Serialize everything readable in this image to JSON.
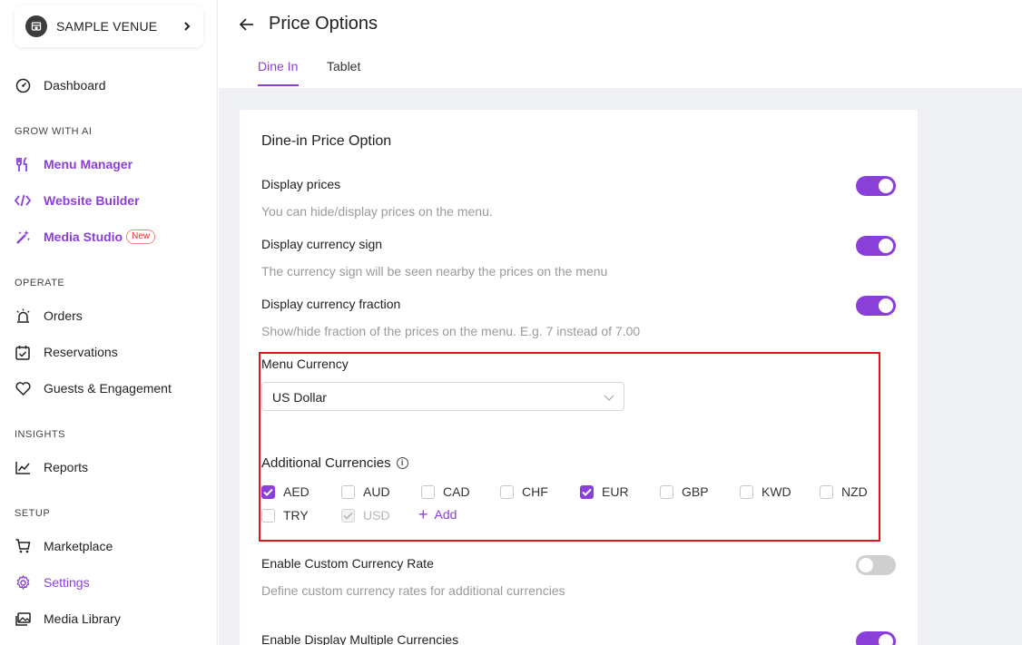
{
  "venue": {
    "name": "SAMPLE VENUE"
  },
  "nav": {
    "dashboard": "Dashboard",
    "grow_label": "GROW WITH AI",
    "menu_manager": "Menu Manager",
    "website_builder": "Website Builder",
    "media_studio": "Media Studio",
    "media_studio_badge": "New",
    "operate_label": "OPERATE",
    "orders": "Orders",
    "reservations": "Reservations",
    "guests": "Guests & Engagement",
    "insights_label": "INSIGHTS",
    "reports": "Reports",
    "setup_label": "SETUP",
    "marketplace": "Marketplace",
    "settings": "Settings",
    "media_library": "Media Library"
  },
  "header": {
    "title": "Price Options",
    "tabs": [
      "Dine In",
      "Tablet"
    ],
    "active_tab": "Dine In"
  },
  "card": {
    "title": "Dine-in Price Option",
    "options": [
      {
        "title": "Display prices",
        "desc": "You can hide/display prices on the menu.",
        "enabled": true
      },
      {
        "title": "Display currency sign",
        "desc": "The currency sign will be seen nearby the prices on the menu",
        "enabled": true
      },
      {
        "title": "Display currency fraction",
        "desc": "Show/hide fraction of the prices on the menu. E.g. 7 instead of 7.00",
        "enabled": true
      }
    ],
    "menu_currency": {
      "label": "Menu Currency",
      "value": "US Dollar"
    },
    "additional": {
      "title": "Additional Currencies",
      "currencies": [
        {
          "code": "AED",
          "checked": true
        },
        {
          "code": "AUD",
          "checked": false
        },
        {
          "code": "CAD",
          "checked": false
        },
        {
          "code": "CHF",
          "checked": false
        },
        {
          "code": "EUR",
          "checked": true
        },
        {
          "code": "GBP",
          "checked": false
        },
        {
          "code": "KWD",
          "checked": false
        },
        {
          "code": "NZD",
          "checked": false
        },
        {
          "code": "TRY",
          "checked": false
        },
        {
          "code": "USD",
          "checked": true,
          "disabled": true
        }
      ],
      "add_label": "Add"
    },
    "custom_rate": {
      "title": "Enable Custom Currency Rate",
      "desc": "Define custom currency rates for additional currencies",
      "enabled": false
    },
    "multi_display": {
      "title": "Enable Display Multiple Currencies",
      "enabled": true
    }
  },
  "colors": {
    "accent": "#8b3fd9",
    "highlight_border": "#e0121b",
    "toggle_off": "#cfcfcf"
  }
}
